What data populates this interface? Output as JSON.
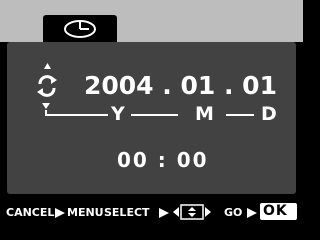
{
  "tab": {
    "icon": "clock-icon",
    "selected": true
  },
  "date": {
    "value": "2004 . 01 . 01",
    "format": {
      "y": "Y",
      "m": "M",
      "d": "D"
    }
  },
  "time": {
    "value": "00 : 00"
  },
  "icons": {
    "adjust": "up-down-cycle-icon"
  },
  "help": {
    "cancel_label": "CANCEL",
    "menu_label": "MENU",
    "select_label": "SELECT",
    "dpad": "dpad-icon",
    "go_label": "GO",
    "ok_label": "OK"
  },
  "colors": {
    "top_band": "#bdbdbd",
    "panel": "#424242",
    "text": "#ffffff",
    "background": "#000000"
  }
}
